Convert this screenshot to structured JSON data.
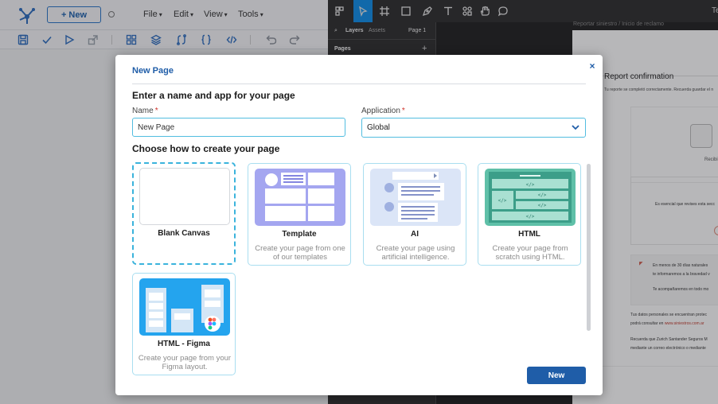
{
  "app": {
    "new_button": "+ New",
    "menus": [
      "File",
      "Edit",
      "View",
      "Tools"
    ]
  },
  "design_tool": {
    "tabs": {
      "layers": "Layers",
      "assets": "Assets",
      "page": "Page 1"
    },
    "pages_label": "Pages",
    "truncated_title": "Te",
    "breadcrumb": "Reportar siniestro / Inicio de reclamo",
    "frame": {
      "title": "Report confirmation",
      "subtitle": "Tu reporte se completó correctamente. Recuerda guardar el n",
      "received": "Recibi",
      "essential": "Es esencial que revises esta secc",
      "notice_1": "En menos de 30 días naturales",
      "notice_2": "te informaremos a la bravedad v",
      "notice_3": "Te acompañaremos en todo mo",
      "privacy_1": "Tus datos personales se encuentran protec",
      "privacy_2": "podrá consultar en",
      "privacy_link": "www.siniestros.com.ar",
      "contact_1": "Recuerda que Zurich Santander Seguros M",
      "contact_2": "mediante un correo electrónico o mediante"
    }
  },
  "modal": {
    "title": "New Page",
    "close_symbol": "×",
    "section_name": "Enter a name and app for your page",
    "name_label": "Name",
    "name_value": "New Page",
    "required_mark": "*",
    "application_label": "Application",
    "application_value": "Global",
    "section_create": "Choose how to create your page",
    "options": [
      {
        "title": "Blank Canvas",
        "description": ""
      },
      {
        "title": "Template",
        "description": "Create your page from one of our templates"
      },
      {
        "title": "AI",
        "description": "Create your page using artificial intelligence."
      },
      {
        "title": "HTML",
        "description": "Create your page from scratch using HTML."
      },
      {
        "title": "HTML - Figma",
        "description": "Create your page from your Figma layout."
      }
    ],
    "primary_button": "New"
  },
  "colors": {
    "brand_blue": "#1f5da8",
    "focus_cyan": "#52bde0",
    "card_border": "#a9def0",
    "overlay": "rgba(30,32,36,0.32)"
  },
  "icons": {
    "app_toolbar": [
      "save-icon",
      "check-icon",
      "play-icon",
      "export-icon",
      "components-icon",
      "layers-icon",
      "flow-icon",
      "braces-icon",
      "code-icon",
      "undo-icon",
      "redo-icon"
    ],
    "design_toolbar": [
      "main-menu-icon",
      "move-tool-icon",
      "frame-tool-icon",
      "shape-tool-icon",
      "pen-tool-icon",
      "text-tool-icon",
      "resources-icon",
      "hand-tool-icon",
      "comment-icon"
    ]
  }
}
